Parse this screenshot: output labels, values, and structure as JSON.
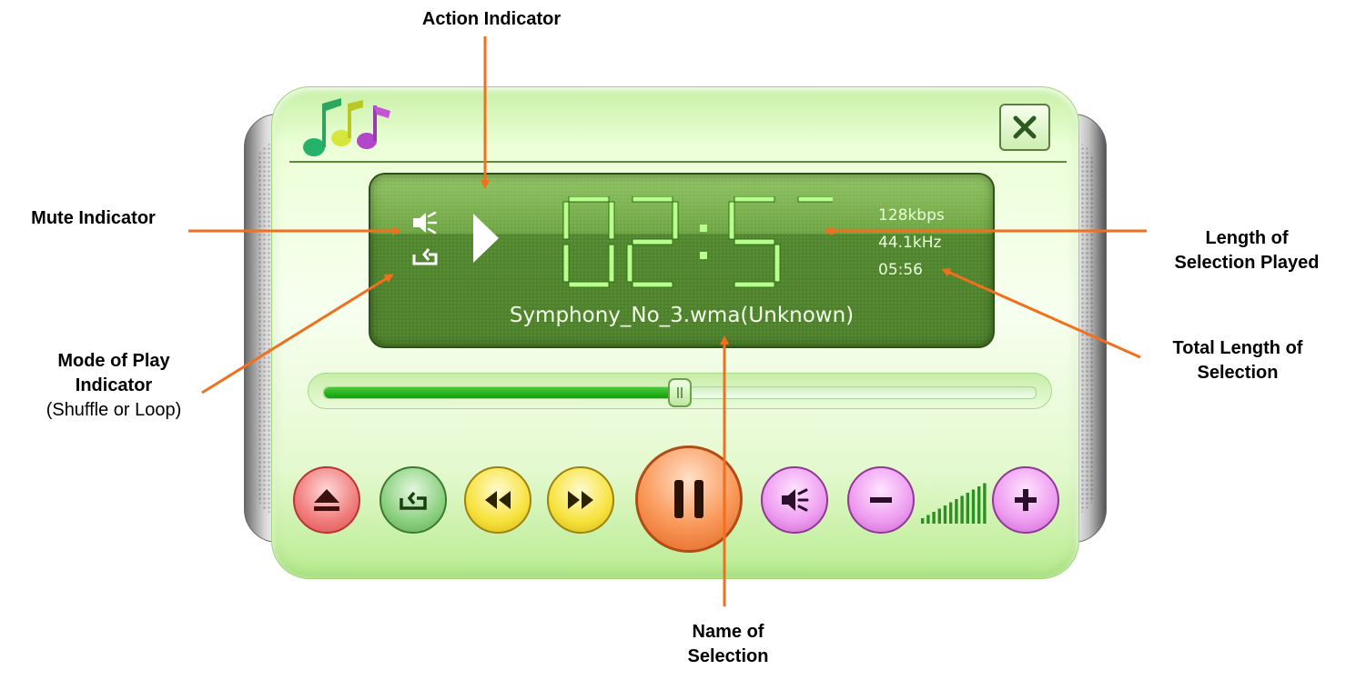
{
  "callouts": {
    "action": "Action Indicator",
    "mute": "Mute Indicator",
    "mode_line1": "Mode of Play",
    "mode_line2": "Indicator",
    "mode_sub": "(Shuffle or Loop)",
    "played_line1": "Length of",
    "played_line2": "Selection Played",
    "total_line1": "Total Length of",
    "total_line2": "Selection",
    "name_line1": "Name of",
    "name_line2": "Selection"
  },
  "display": {
    "elapsed": "02:57",
    "bitrate": "128kbps",
    "sample_rate": "44.1kHz",
    "total": "05:56",
    "track": "Symphony_No_3.wma(Unknown)"
  },
  "seek": {
    "progress": 0.5
  },
  "volume": {
    "level": 1.0
  },
  "colors": {
    "callout_arrow": "#f26f1d",
    "lcd_text": "#e9ffd9",
    "digit": "#b9ff8c"
  },
  "icons": {
    "logo": "music-notes-icon",
    "close": "close-icon",
    "mute": "speaker-mute-icon",
    "mode": "repeat-icon",
    "action": "play-icon",
    "eject": "eject-icon",
    "repeat": "repeat-icon",
    "prev": "rewind-icon",
    "next": "fast-forward-icon",
    "pause": "pause-icon",
    "mute_button": "speaker-mute-icon",
    "vol_down": "minus-icon",
    "vol_up": "plus-icon"
  }
}
